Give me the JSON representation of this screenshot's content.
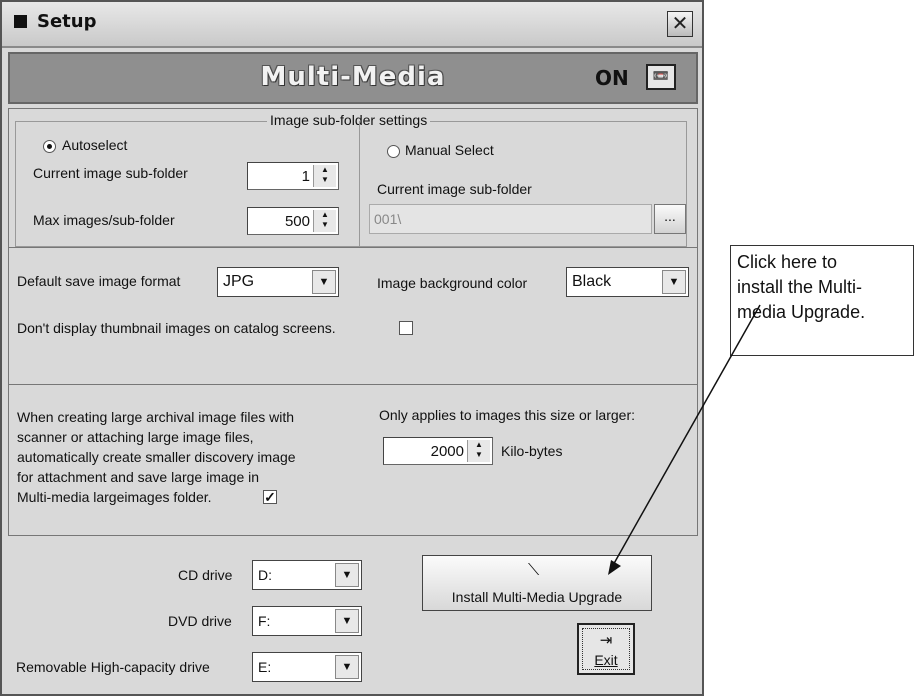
{
  "window": {
    "title": "Setup"
  },
  "header": {
    "title": "Multi-Media",
    "status": "ON"
  },
  "subfolder": {
    "legend": "Image sub-folder settings",
    "autoselect_label": "Autoselect",
    "current_label": "Current image sub-folder",
    "current_value": "1",
    "max_label": "Max images/sub-folder",
    "max_value": "500",
    "manual_label": "Manual Select",
    "manual_current_label": "Current image sub-folder",
    "manual_path": "001\\",
    "browse_label": "..."
  },
  "format": {
    "save_format_label": "Default save image format",
    "save_format_value": "JPG",
    "bg_color_label": "Image background color",
    "bg_color_value": "Black",
    "thumbnail_label": "Don't display thumbnail images on catalog screens."
  },
  "archival": {
    "description_lines": [
      "When creating large archival image files with",
      "scanner or attaching large image files,",
      "automatically create smaller discovery image",
      "for attachment and save large image in",
      "Multi-media largeimages folder."
    ],
    "checkbox_checked": true,
    "size_label": "Only applies to images this size or larger:",
    "size_value": "2000",
    "size_unit": "Kilo-bytes"
  },
  "drives": {
    "cd_label": "CD drive",
    "cd_value": "D:",
    "dvd_label": "DVD drive",
    "dvd_value": "F:",
    "removable_label": "Removable High-capacity drive",
    "removable_value": "E:"
  },
  "buttons": {
    "install_label": "Install Multi-Media Upgrade",
    "exit_label": "Exit"
  },
  "callout": {
    "lines": [
      "Click here to",
      "install the Multi-",
      "media Upgrade."
    ]
  }
}
